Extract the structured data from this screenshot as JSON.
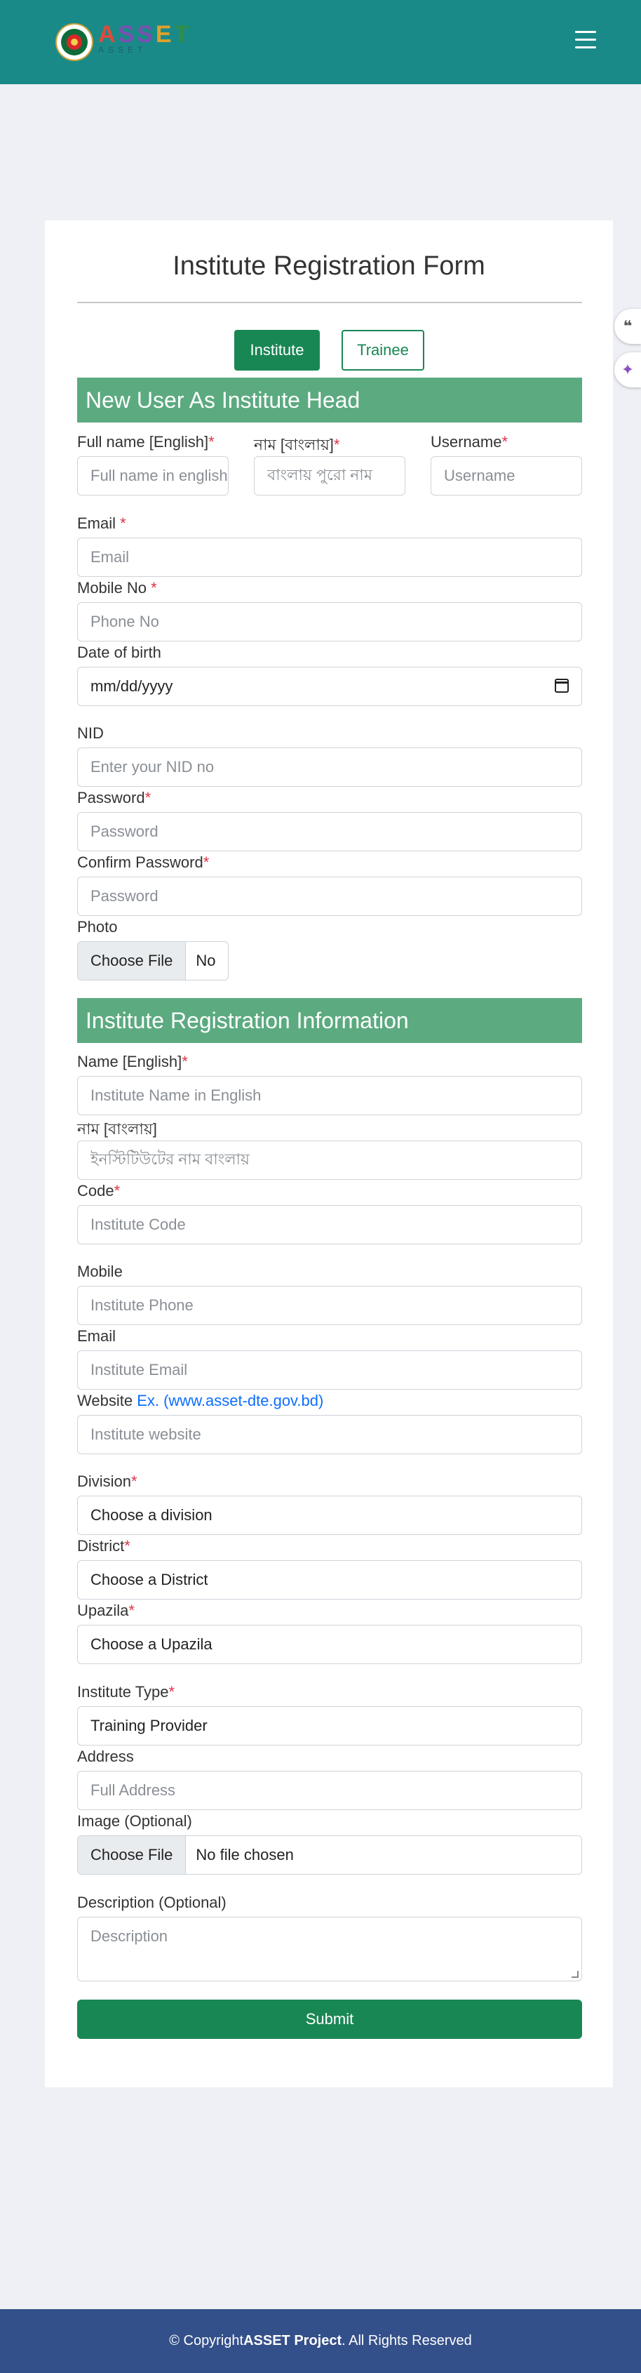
{
  "navbar": {
    "logo_text_1": "A",
    "logo_text_2": "SS",
    "logo_text_3": "E",
    "logo_text_4": "T",
    "logo_subtext": "ASSET",
    "menu_icon": "hamburger-icon",
    "bg_color": "#1a8a88"
  },
  "form": {
    "title": "Institute Registration Form",
    "tabs": [
      "Institute",
      "Trainee"
    ],
    "active_tab": "Institute",
    "section_user": "New User As Institute Head",
    "section_institute": "Institute Registration Information",
    "user": {
      "fullname_label": "Full name [English]",
      "fullname_placeholder": "Full name in english",
      "bn_name_label": "নাম [বাংলায়]",
      "bn_name_placeholder": "বাংলায় পুরো নাম",
      "username_label": "Username",
      "username_placeholder": "Username",
      "email_label": "Email ",
      "email_placeholder": "Email",
      "mobile_label": "Mobile No ",
      "mobile_placeholder": "Phone No",
      "dob_label": "Date of birth",
      "dob_value": "mm/dd/yyyy",
      "nid_label": "NID",
      "nid_placeholder": "Enter your NID no",
      "password_label": "Password",
      "password_placeholder": "Password",
      "confirm_label": "Confirm Password",
      "confirm_placeholder": "Password",
      "photo_label": "Photo",
      "photo_button": "Choose File",
      "photo_status": "No"
    },
    "institute": {
      "name_label": "Name [English]",
      "name_placeholder": "Institute Name in English",
      "bn_name_label": "নাম [বাংলায়]",
      "bn_name_placeholder": "ইনস্টিটিউটের নাম বাংলায়",
      "code_label": "Code",
      "code_placeholder": "Institute Code",
      "mobile_label": "Mobile",
      "mobile_placeholder": "Institute Phone",
      "email_label": "Email",
      "email_placeholder": "Institute Email",
      "website_label": "Website ",
      "website_hint": "Ex. (www.asset-dte.gov.bd)",
      "website_placeholder": "Institute website",
      "division_label": "Division",
      "division_value": "Choose a division",
      "district_label": "District",
      "district_value": "Choose a District",
      "upazila_label": "Upazila",
      "upazila_value": "Choose a Upazila",
      "type_label": "Institute Type",
      "type_value": "Training Provider",
      "address_label": "Address",
      "address_placeholder": "Full Address",
      "image_label": "Image (Optional)",
      "image_button": "Choose File",
      "image_status": "No file chosen",
      "desc_label": "Description (Optional)",
      "desc_placeholder": "Description"
    },
    "required_mark": "*",
    "submit_label": "Submit"
  },
  "side_tabs": {
    "quote_icon": "❝",
    "spark_icon": "✦"
  },
  "footer": {
    "prefix": "© Copyright ",
    "brand": "ASSET Project",
    "suffix": ". All Rights Reserved"
  }
}
